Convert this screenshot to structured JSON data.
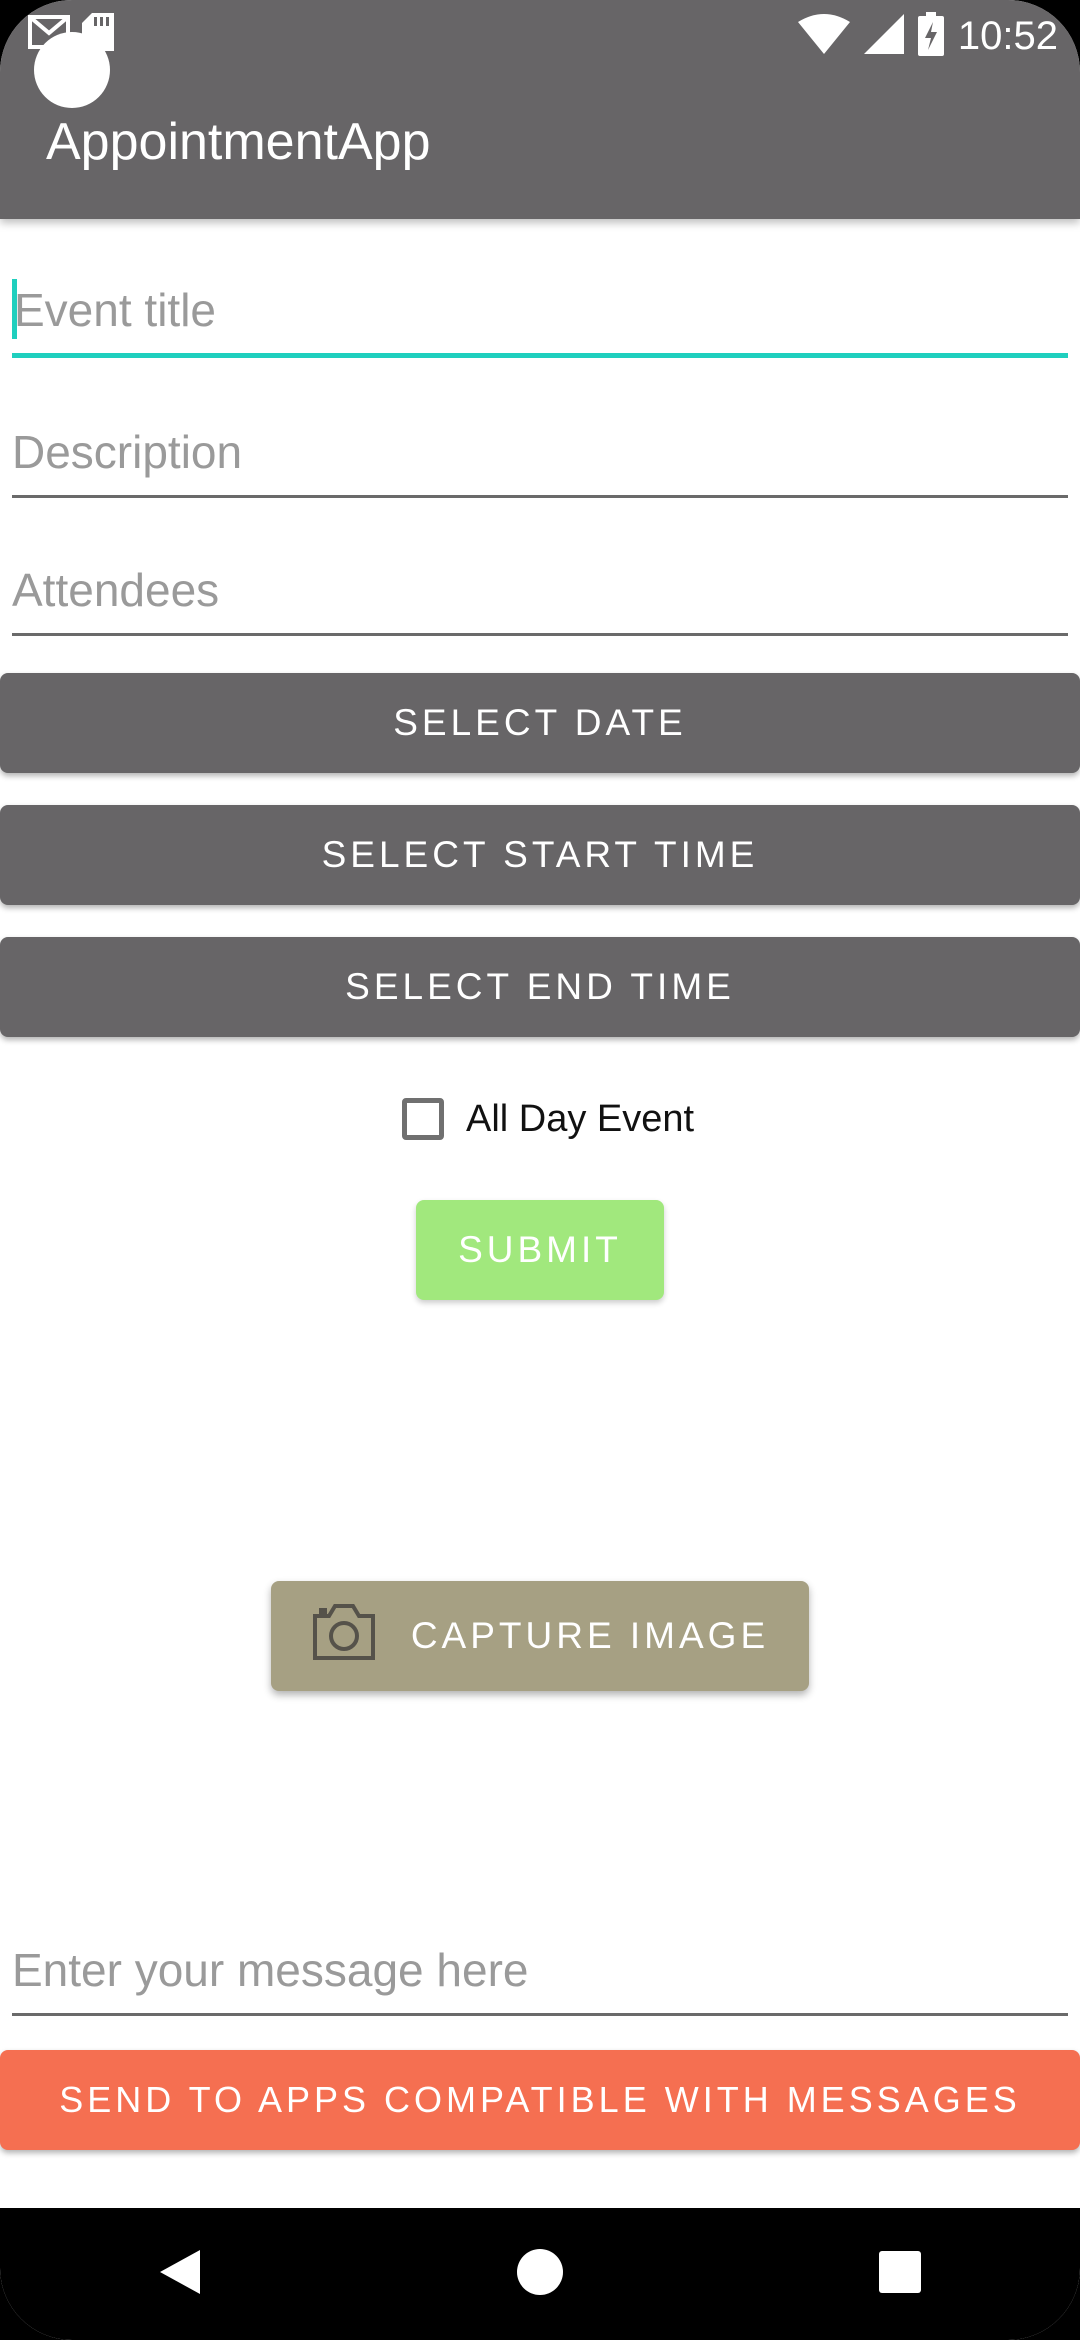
{
  "status_bar": {
    "time": "10:52",
    "icons": [
      "gmail-icon",
      "sd-card-icon",
      "wifi-icon",
      "signal-icon",
      "battery-charging-icon"
    ]
  },
  "app_bar": {
    "title": "AppointmentApp"
  },
  "form": {
    "event_title_placeholder": "Event title",
    "description_placeholder": "Description",
    "attendees_placeholder": "Attendees",
    "select_date_label": "SELECT DATE",
    "select_start_time_label": "SELECT START TIME",
    "select_end_time_label": "SELECT END TIME",
    "all_day_label": "All Day Event",
    "all_day_checked": false,
    "submit_label": "SUBMIT"
  },
  "capture": {
    "label": "CAPTURE IMAGE",
    "icon": "camera-icon"
  },
  "message": {
    "placeholder": "Enter your message here",
    "send_label": "SEND TO APPS COMPATIBLE WITH MESSAGES"
  },
  "colors": {
    "app_bar": "#676567",
    "accent": "#1fcfbe",
    "submit": "#a1e87d",
    "capture": "#a6a083",
    "send": "#f56f51"
  },
  "nav_bar": {
    "icons": [
      "back-icon",
      "home-icon",
      "recents-icon"
    ]
  }
}
